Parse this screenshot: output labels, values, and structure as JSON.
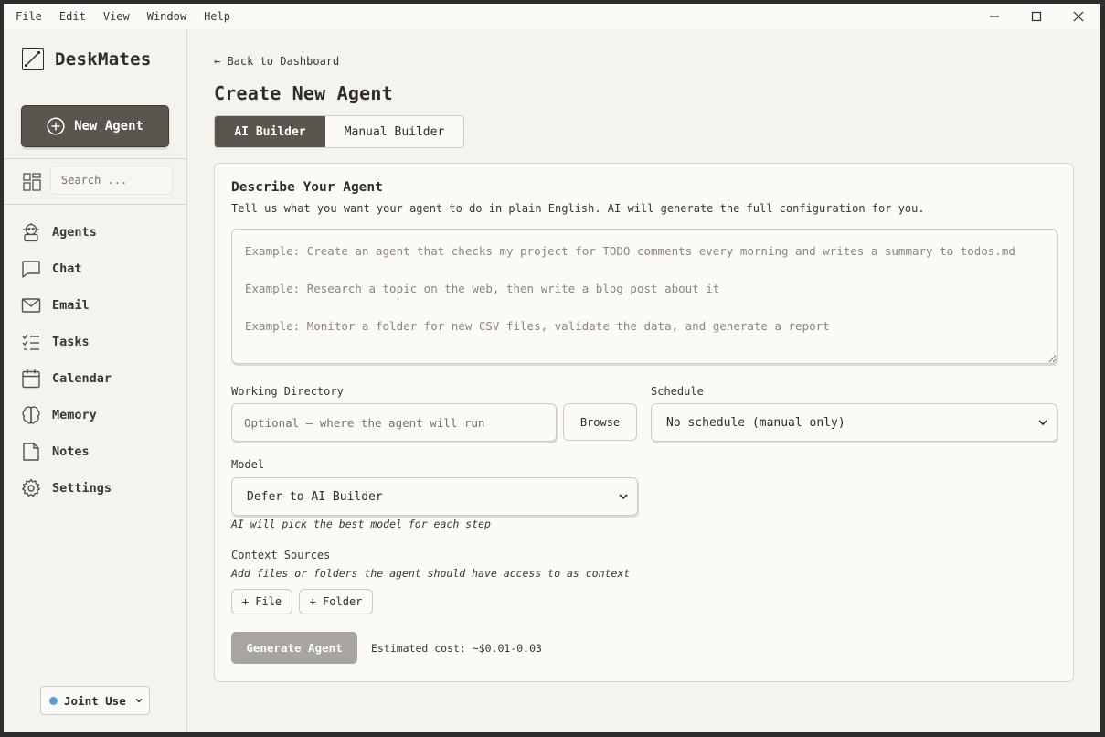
{
  "menubar": {
    "items": [
      "File",
      "Edit",
      "View",
      "Window",
      "Help"
    ]
  },
  "window_controls": [
    "minimize-icon",
    "maximize-icon",
    "close-icon"
  ],
  "sidebar": {
    "app_name": "DeskMates",
    "new_agent_label": "New Agent",
    "search_placeholder": "Search ...",
    "items": [
      {
        "label": "Agents",
        "icon": "robot-icon"
      },
      {
        "label": "Chat",
        "icon": "chat-bubble-icon"
      },
      {
        "label": "Email",
        "icon": "envelope-icon"
      },
      {
        "label": "Tasks",
        "icon": "checklist-icon"
      },
      {
        "label": "Calendar",
        "icon": "calendar-icon"
      },
      {
        "label": "Memory",
        "icon": "brain-icon"
      },
      {
        "label": "Notes",
        "icon": "note-icon"
      },
      {
        "label": "Settings",
        "icon": "gear-icon"
      }
    ],
    "mode_selector": {
      "label": "Joint Use",
      "dot_color": "#5b9bd5"
    }
  },
  "main": {
    "back_link": "← Back to Dashboard",
    "title": "Create New Agent",
    "tabs": [
      {
        "label": "AI Builder",
        "active": true
      },
      {
        "label": "Manual Builder",
        "active": false
      }
    ],
    "card": {
      "title": "Describe Your Agent",
      "subtitle": "Tell us what you want your agent to do in plain English. AI will generate the full configuration for you.",
      "description_placeholder": "Example: Create an agent that checks my project for TODO comments every morning and writes a summary to todos.md\n\nExample: Research a topic on the web, then write a blog post about it\n\nExample: Monitor a folder for new CSV files, validate the data, and generate a report",
      "working_directory": {
        "label": "Working Directory",
        "placeholder": "Optional — where the agent will run",
        "browse_label": "Browse"
      },
      "schedule": {
        "label": "Schedule",
        "value": "No schedule (manual only)"
      },
      "model": {
        "label": "Model",
        "value": "Defer to AI Builder",
        "hint": "AI will pick the best model for each step"
      },
      "context_sources": {
        "label": "Context Sources",
        "hint": "Add files or folders the agent should have access to as context",
        "file_button": "+ File",
        "folder_button": "+ Folder"
      },
      "generate_label": "Generate Agent",
      "estimated_cost": "Estimated cost: ~$0.01-0.03"
    }
  },
  "colors": {
    "accent_dark": "#5b5550",
    "background": "#f5f3ee",
    "surface": "#fbfaf7",
    "disabled_button": "#a8a49f"
  }
}
